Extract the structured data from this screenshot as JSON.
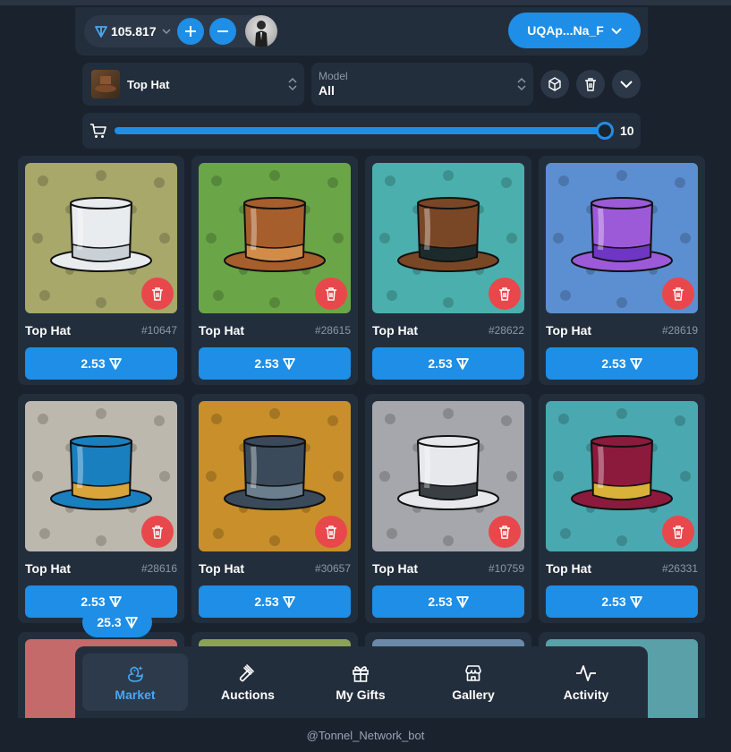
{
  "header": {
    "balance": "105.817",
    "wallet_label": "UQAp...Na_F"
  },
  "filters": {
    "gift_name": "Top Hat",
    "model_label": "Model",
    "model_value": "All"
  },
  "slider": {
    "value": "10",
    "level_fraction": 1.0
  },
  "cards": [
    {
      "name": "Top Hat",
      "number": "#10647",
      "price": "2.53",
      "bg": "#a7a86a",
      "hat": "#e9ecef",
      "band": "#c9d0d6"
    },
    {
      "name": "Top Hat",
      "number": "#28615",
      "price": "2.53",
      "bg": "#6aa648",
      "hat": "#a65e2c",
      "band": "#d18c4a"
    },
    {
      "name": "Top Hat",
      "number": "#28622",
      "price": "2.53",
      "bg": "#4bb0ad",
      "hat": "#7a4726",
      "band": "#1d2a2c"
    },
    {
      "name": "Top Hat",
      "number": "#28619",
      "price": "2.53",
      "bg": "#5c8fd2",
      "hat": "#9c5ad8",
      "band": "#6e36c2"
    },
    {
      "name": "Top Hat",
      "number": "#28616",
      "price": "2.53",
      "bg": "#bdb8ae",
      "hat": "#1a7fbf",
      "band": "#d9a53a"
    },
    {
      "name": "Top Hat",
      "number": "#30657",
      "price": "2.53",
      "bg": "#c98f2a",
      "hat": "#3a4a5a",
      "band": "#6a7e8e"
    },
    {
      "name": "Top Hat",
      "number": "#10759",
      "price": "2.53",
      "bg": "#a6a7ad",
      "hat": "#e6e8eb",
      "band": "#3a3f44"
    },
    {
      "name": "Top Hat",
      "number": "#26331",
      "price": "2.53",
      "bg": "#4aa8b0",
      "hat": "#8c1a3c",
      "band": "#d9b23a"
    }
  ],
  "partial_cards": [
    {
      "bg": "#c46a6a"
    },
    {
      "bg": "#8aa25a"
    },
    {
      "bg": "#6a8aa8"
    },
    {
      "bg": "#5aa0a8"
    }
  ],
  "total": "25.3",
  "nav": [
    {
      "label": "Market",
      "icon": "duck-icon",
      "active": true
    },
    {
      "label": "Auctions",
      "icon": "gavel-icon",
      "active": false
    },
    {
      "label": "My Gifts",
      "icon": "gift-icon",
      "active": false
    },
    {
      "label": "Gallery",
      "icon": "store-icon",
      "active": false
    },
    {
      "label": "Activity",
      "icon": "pulse-icon",
      "active": false
    }
  ],
  "footer": "@Tonnel_Network_bot",
  "colors": {
    "accent": "#1e8ee6",
    "danger": "#e8484b",
    "panel": "#232e3c",
    "background": "#1a222d"
  }
}
